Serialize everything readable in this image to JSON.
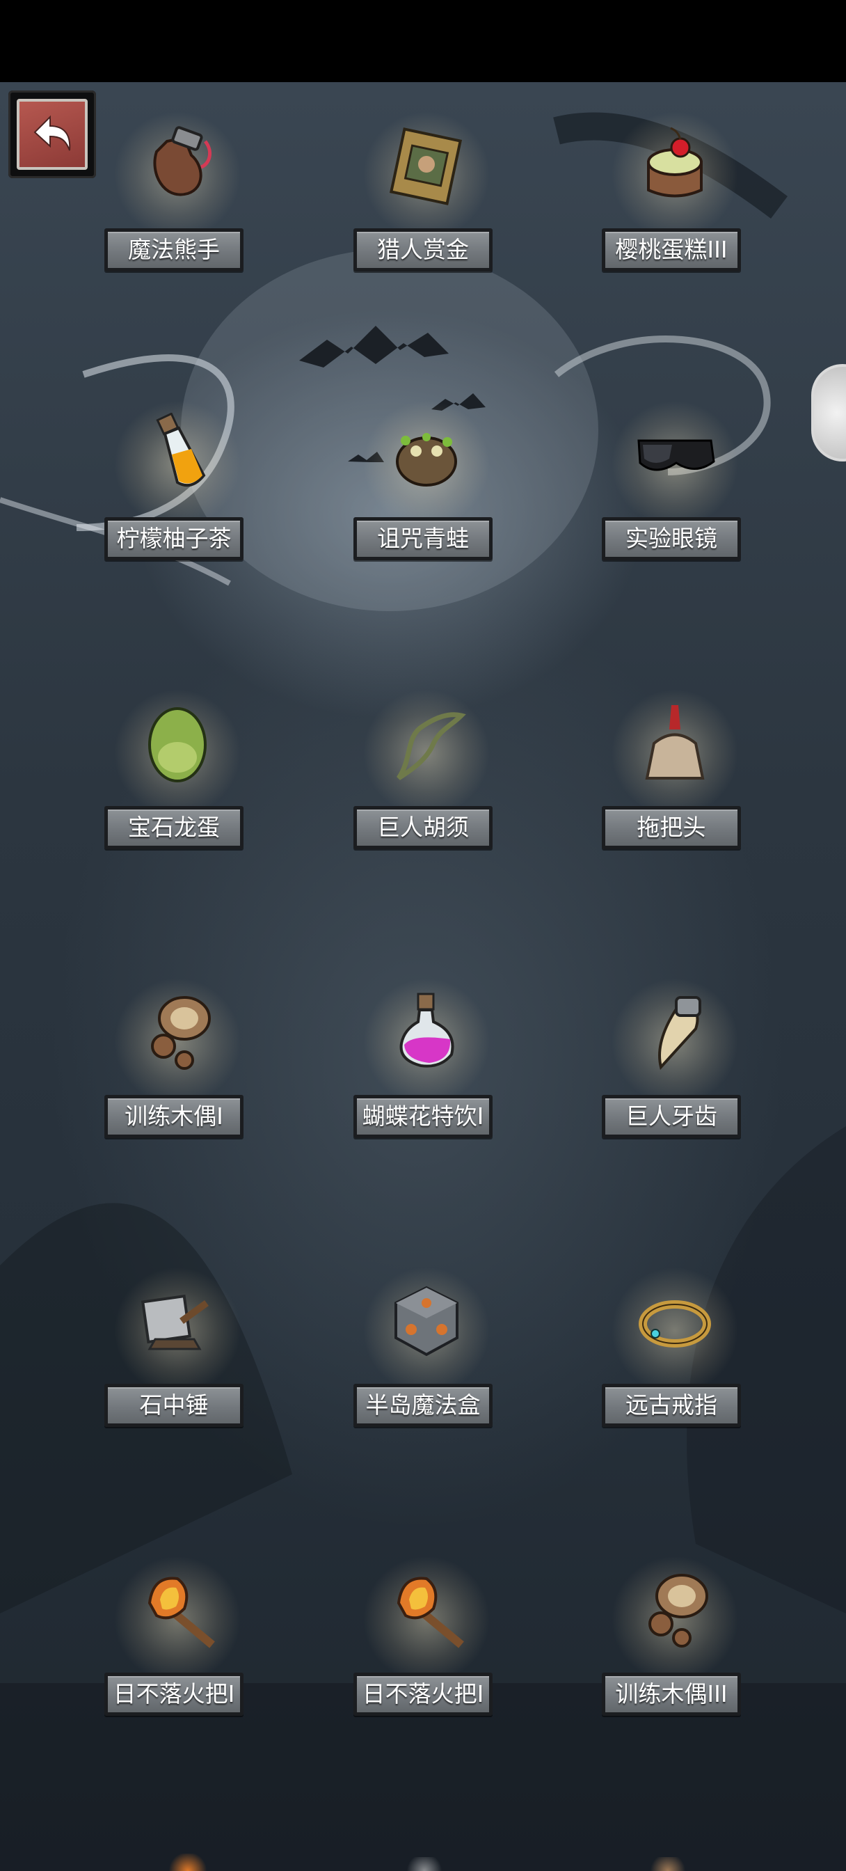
{
  "back_button": {
    "icon": "return-arrow-icon"
  },
  "items": [
    {
      "name": "魔法熊手",
      "icon": "bear-paw-icon"
    },
    {
      "name": "猎人赏金",
      "icon": "wanted-poster-icon"
    },
    {
      "name": "樱桃蛋糕III",
      "icon": "cherry-cake-icon"
    },
    {
      "name": "柠檬柚子茶",
      "icon": "lemon-tea-bottle-icon"
    },
    {
      "name": "诅咒青蛙",
      "icon": "cursed-frog-icon"
    },
    {
      "name": "实验眼镜",
      "icon": "lab-goggles-icon"
    },
    {
      "name": "宝石龙蛋",
      "icon": "gem-dragon-egg-icon"
    },
    {
      "name": "巨人胡须",
      "icon": "giant-beard-icon"
    },
    {
      "name": "拖把头",
      "icon": "mop-head-icon"
    },
    {
      "name": "训练木偶I",
      "icon": "training-dummy-icon"
    },
    {
      "name": "蝴蝶花特饮I",
      "icon": "pink-potion-icon"
    },
    {
      "name": "巨人牙齿",
      "icon": "giant-tooth-icon"
    },
    {
      "name": "石中锤",
      "icon": "stone-hammer-icon"
    },
    {
      "name": "半岛魔法盒",
      "icon": "magic-cube-icon"
    },
    {
      "name": "远古戒指",
      "icon": "ancient-ring-icon"
    },
    {
      "name": "日不落火把I",
      "icon": "torch-icon"
    },
    {
      "name": "日不落火把I",
      "icon": "torch-icon"
    },
    {
      "name": "训练木偶III",
      "icon": "training-dummy-icon"
    }
  ],
  "colors": {
    "label_bg": "#7a7f84",
    "back_button_bg": "#a24a44",
    "sky": "#2c3640"
  }
}
